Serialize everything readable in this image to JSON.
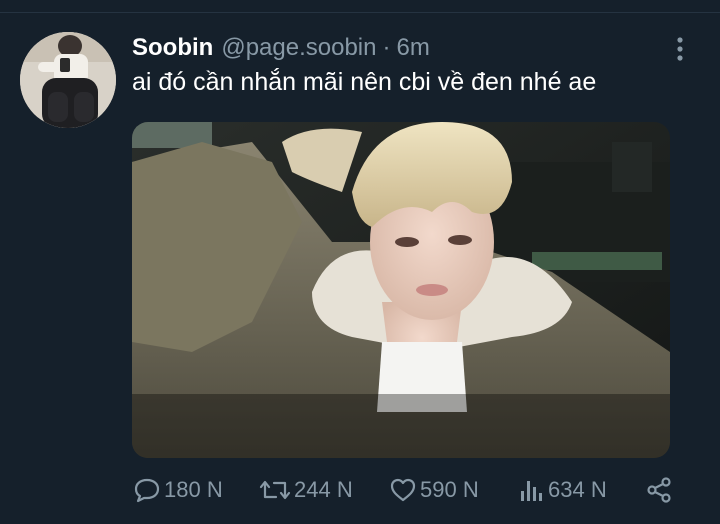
{
  "tweet": {
    "author": {
      "name": "Soobin",
      "handle": "@page.soobin",
      "separator": "·",
      "time": "6m"
    },
    "text": "ai đó cần nhắn mãi nên cbi về đen nhé ae",
    "actions": {
      "reply_count": "180 N",
      "retweet_count": "244 N",
      "like_count": "590 N",
      "views_count": "634 N"
    }
  },
  "icons": {
    "reply": "comment-icon",
    "retweet": "retweet-icon",
    "like": "heart-icon",
    "views": "bar-chart-icon",
    "share": "share-icon",
    "more": "more-vertical-icon"
  },
  "colors": {
    "background": "#15202b",
    "text_primary": "#ffffff",
    "text_secondary": "#8899a6",
    "divider": "#253341"
  }
}
